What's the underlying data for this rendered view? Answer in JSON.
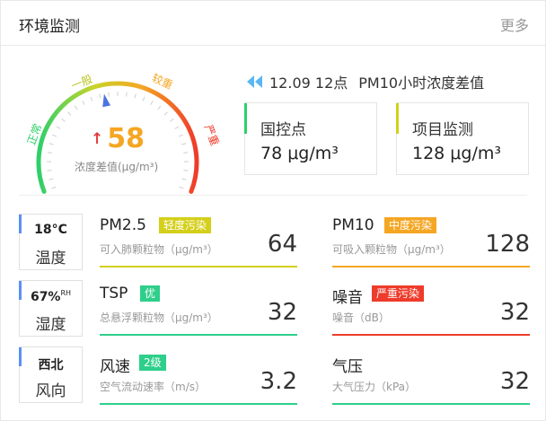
{
  "header": {
    "title": "环境监测",
    "more": "更多"
  },
  "gauge": {
    "labels": {
      "normal": "正常",
      "mild": "一般",
      "heavy": "较重",
      "severe": "严重"
    },
    "value": "58",
    "caption": "浓度差值(μg/m³)",
    "level_fraction": 0.45,
    "colors": {
      "start": "#2ecf6a",
      "mid1": "#c8d42a",
      "mid2": "#f5a623",
      "end": "#ee3b2b",
      "pointer": "#4a74e0"
    }
  },
  "info": {
    "date": "12.09 12点",
    "desc": "PM10小时浓度差值",
    "boxes": [
      {
        "label": "国控点",
        "value": "78 μg/m³",
        "color": "#2ecf6a"
      },
      {
        "label": "项目监测",
        "value": "128 μg/m³",
        "color": "#d4cf1a"
      }
    ]
  },
  "weather": [
    {
      "top": "18°C",
      "sup": "",
      "bottom": "温度"
    },
    {
      "top": "67%",
      "sup": "RH",
      "bottom": "湿度"
    },
    {
      "top": "西北",
      "sup": "",
      "bottom": "风向"
    }
  ],
  "metrics": [
    {
      "name": "PM2.5",
      "tag": "轻度污染",
      "tag_color": "#d4cf1a",
      "sub": "可入肺颗粒物（μg/m³）",
      "value": "64",
      "line_color": "#d4cf1a"
    },
    {
      "name": "PM10",
      "tag": "中度污染",
      "tag_color": "#f5a623",
      "sub": "可吸入颗粒物（μg/m³）",
      "value": "128",
      "line_color": "#f5a623"
    },
    {
      "name": "TSP",
      "tag": "优",
      "tag_color": "#2ecf8a",
      "sub": "总悬浮颗粒物（μg/m³）",
      "value": "32",
      "line_color": "#2ecf8a"
    },
    {
      "name": "噪音",
      "tag": "严重污染",
      "tag_color": "#ee3b2b",
      "sub": "噪音（dB）",
      "value": "32",
      "line_color": "#ee3b2b"
    },
    {
      "name": "风速",
      "tag": "2级",
      "tag_color": "#2ecf8a",
      "sub": "空气流动速率（m/s）",
      "value": "3.2",
      "line_color": "#2ecf8a"
    },
    {
      "name": "气压",
      "tag": "",
      "tag_color": "",
      "sub": "大气压力（kPa）",
      "value": "32",
      "line_color": "#2ecf8a"
    }
  ]
}
